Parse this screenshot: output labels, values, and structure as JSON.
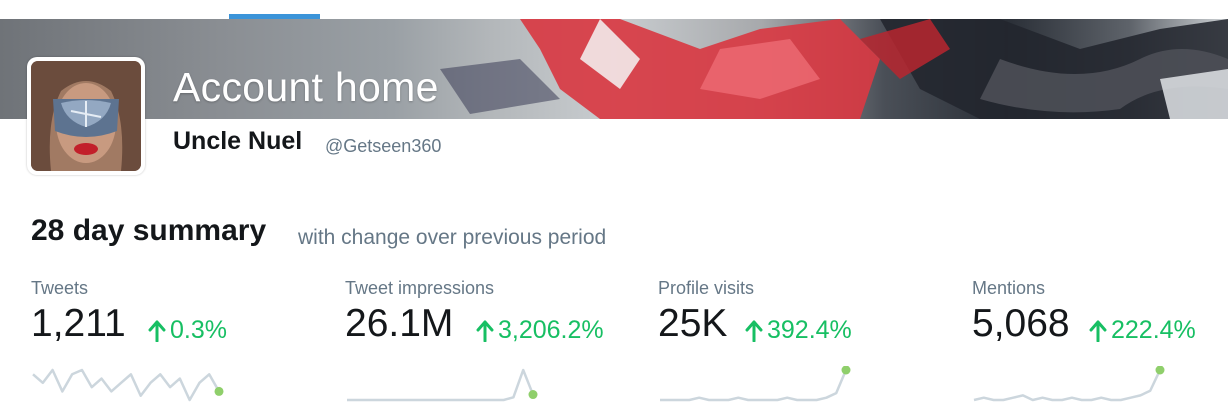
{
  "header": {
    "title": "Account home",
    "display_name": "Uncle Nuel",
    "handle": "@Getseen360"
  },
  "summary": {
    "title": "28 day summary",
    "subtitle": "with change over previous period"
  },
  "metrics": [
    {
      "label": "Tweets",
      "value": "1,211",
      "change": "0.3%",
      "trend": "up",
      "sparkline": [
        8,
        6,
        9,
        4,
        8,
        9,
        5,
        7,
        4,
        6,
        8,
        3,
        6,
        8,
        5,
        7,
        2,
        6,
        8,
        4
      ]
    },
    {
      "label": "Tweet impressions",
      "value": "26.1M",
      "change": "3,206.2%",
      "trend": "up",
      "sparkline": [
        3,
        3,
        3,
        3,
        3,
        3,
        3,
        3,
        3,
        3,
        3,
        3,
        3,
        3,
        3,
        3,
        3,
        4,
        14,
        5
      ]
    },
    {
      "label": "Profile visits",
      "value": "25K",
      "change": "392.4%",
      "trend": "up",
      "sparkline": [
        3,
        3,
        3,
        3,
        4,
        3,
        3,
        3,
        4,
        3,
        3,
        3,
        3,
        4,
        3,
        3,
        3,
        4,
        6,
        16
      ]
    },
    {
      "label": "Mentions",
      "value": "5,068",
      "change": "222.4%",
      "trend": "up",
      "sparkline": [
        3,
        4,
        3,
        3,
        4,
        5,
        3,
        4,
        3,
        3,
        4,
        3,
        3,
        4,
        3,
        3,
        4,
        5,
        7,
        16
      ]
    }
  ],
  "colors": {
    "accent": "#3b94d9",
    "positive": "#17bf63",
    "sparkline": "#ccd6dd",
    "sparkline_point": "#8fcf6b"
  }
}
